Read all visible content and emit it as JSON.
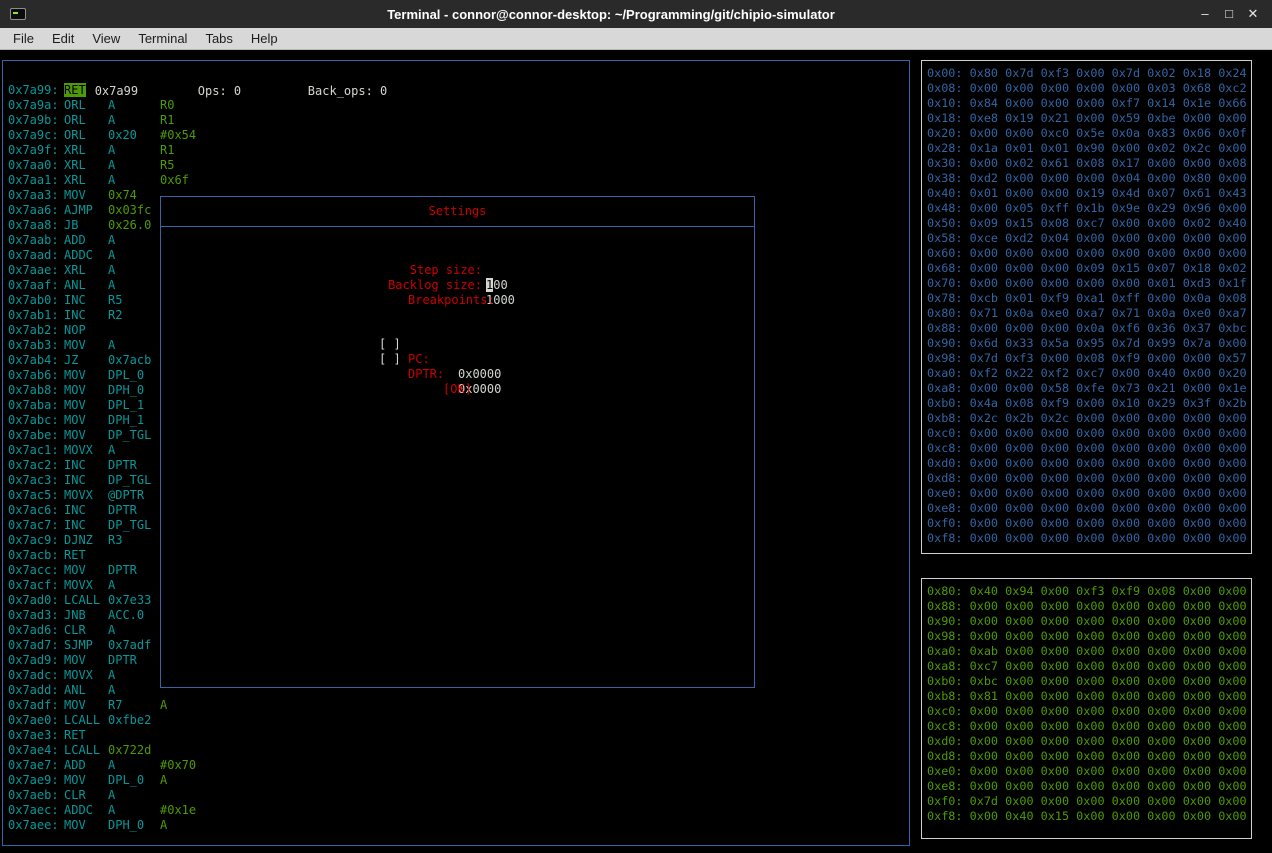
{
  "colors": {
    "cyan": "#06989a",
    "green": "#4e9a06",
    "blue": "#3465a4",
    "red": "#cc0000",
    "fg": "#d3d7cf"
  },
  "window": {
    "title": "Terminal - connor@connor-desktop: ~/Programming/git/chipio-simulator",
    "controls": {
      "minimize": "–",
      "maximize": "□",
      "close": "✕"
    }
  },
  "menubar": {
    "items": [
      "File",
      "Edit",
      "View",
      "Terminal",
      "Tabs",
      "Help"
    ]
  },
  "status_line": {
    "pc": "PC: 0x7a99",
    "ops": "Ops: 0",
    "back_ops": "Back_ops: 0"
  },
  "disassembly": {
    "rows": [
      {
        "a": "0x7a99:",
        "m": "RET",
        "cur": true
      },
      {
        "a": "0x7a9a:",
        "m": "ORL",
        "o1": "A",
        "o2": "R0"
      },
      {
        "a": "0x7a9b:",
        "m": "ORL",
        "o1": "A",
        "o2": "R1"
      },
      {
        "a": "0x7a9c:",
        "m": "ORL",
        "o1": "0x20",
        "o2": "#0x54"
      },
      {
        "a": "0x7a9f:",
        "m": "XRL",
        "o1": "A",
        "o2": "R1"
      },
      {
        "a": "0x7aa0:",
        "m": "XRL",
        "o1": "A",
        "o2": "R5"
      },
      {
        "a": "0x7aa1:",
        "m": "XRL",
        "o1": "A",
        "o2": "0x6f"
      },
      {
        "a": "0x7aa3:",
        "m": "MOV",
        "o1": "0x74",
        "g": true
      },
      {
        "a": "0x7aa6:",
        "m": "AJMP",
        "o1": "0x03fc",
        "g": true
      },
      {
        "a": "0x7aa8:",
        "m": "JB",
        "o1": "0x26.0",
        "g": true
      },
      {
        "a": "0x7aab:",
        "m": "ADD",
        "o1": "A"
      },
      {
        "a": "0x7aad:",
        "m": "ADDC",
        "o1": "A"
      },
      {
        "a": "0x7aae:",
        "m": "XRL",
        "o1": "A"
      },
      {
        "a": "0x7aaf:",
        "m": "ANL",
        "o1": "A"
      },
      {
        "a": "0x7ab0:",
        "m": "INC",
        "o1": "R5"
      },
      {
        "a": "0x7ab1:",
        "m": "INC",
        "o1": "R2"
      },
      {
        "a": "0x7ab2:",
        "m": "NOP"
      },
      {
        "a": "0x7ab3:",
        "m": "MOV",
        "o1": "A"
      },
      {
        "a": "0x7ab4:",
        "m": "JZ",
        "o1": "0x7acb"
      },
      {
        "a": "0x7ab6:",
        "m": "MOV",
        "o1": "DPL_0"
      },
      {
        "a": "0x7ab8:",
        "m": "MOV",
        "o1": "DPH_0"
      },
      {
        "a": "0x7aba:",
        "m": "MOV",
        "o1": "DPL_1"
      },
      {
        "a": "0x7abc:",
        "m": "MOV",
        "o1": "DPH_1"
      },
      {
        "a": "0x7abe:",
        "m": "MOV",
        "o1": "DP_TGL"
      },
      {
        "a": "0x7ac1:",
        "m": "MOVX",
        "o1": "A"
      },
      {
        "a": "0x7ac2:",
        "m": "INC",
        "o1": "DPTR"
      },
      {
        "a": "0x7ac3:",
        "m": "INC",
        "o1": "DP_TGL"
      },
      {
        "a": "0x7ac5:",
        "m": "MOVX",
        "o1": "@DPTR"
      },
      {
        "a": "0x7ac6:",
        "m": "INC",
        "o1": "DPTR"
      },
      {
        "a": "0x7ac7:",
        "m": "INC",
        "o1": "DP_TGL"
      },
      {
        "a": "0x7ac9:",
        "m": "DJNZ",
        "o1": "R3"
      },
      {
        "a": "0x7acb:",
        "m": "RET"
      },
      {
        "a": "0x7acc:",
        "m": "MOV",
        "o1": "DPTR"
      },
      {
        "a": "0x7acf:",
        "m": "MOVX",
        "o1": "A"
      },
      {
        "a": "0x7ad0:",
        "m": "LCALL",
        "o1": "0x7e33"
      },
      {
        "a": "0x7ad3:",
        "m": "JNB",
        "o1": "ACC.0"
      },
      {
        "a": "0x7ad6:",
        "m": "CLR",
        "o1": "A"
      },
      {
        "a": "0x7ad7:",
        "m": "SJMP",
        "o1": "0x7adf"
      },
      {
        "a": "0x7ad9:",
        "m": "MOV",
        "o1": "DPTR"
      },
      {
        "a": "0x7adc:",
        "m": "MOVX",
        "o1": "A"
      },
      {
        "a": "0x7add:",
        "m": "ANL",
        "o1": "A"
      },
      {
        "a": "0x7adf:",
        "m": "MOV",
        "o1": "R7",
        "o2": "A"
      },
      {
        "a": "0x7ae0:",
        "m": "LCALL",
        "o1": "0xfbe2"
      },
      {
        "a": "0x7ae3:",
        "m": "RET"
      },
      {
        "a": "0x7ae4:",
        "m": "LCALL",
        "o1": "0x722d",
        "g": true
      },
      {
        "a": "0x7ae7:",
        "m": "ADD",
        "o1": "A",
        "o2": "#0x70"
      },
      {
        "a": "0x7ae9:",
        "m": "MOV",
        "o1": "DPL_0",
        "o2": "A"
      },
      {
        "a": "0x7aeb:",
        "m": "CLR",
        "o1": "A"
      },
      {
        "a": "0x7aec:",
        "m": "ADDC",
        "o1": "A",
        "o2": "#0x1e"
      },
      {
        "a": "0x7aee:",
        "m": "MOV",
        "o1": "DPH_0",
        "o2": "A"
      }
    ]
  },
  "settings_dialog": {
    "title": "Settings",
    "fields": [
      {
        "label": "Step size:",
        "value": "100",
        "cursor_index": 0
      },
      {
        "label": "Backlog size:",
        "value": "1000"
      }
    ],
    "breakpoints_heading": "Breakpoints:",
    "breakpoints": [
      {
        "checkbox": "[ ]",
        "label": "PC:",
        "value": "0x0000"
      },
      {
        "checkbox": "[ ]",
        "label": "DPTR:",
        "value": "0x0000"
      }
    ],
    "ok_button": "[OK]"
  },
  "memory_internal": {
    "rows": [
      {
        "a": "0x00:",
        "v": [
          "0x80",
          "0x7d",
          "0xf3",
          "0x00",
          "0x7d",
          "0x02",
          "0x18",
          "0x24"
        ]
      },
      {
        "a": "0x08:",
        "v": [
          "0x00",
          "0x00",
          "0x00",
          "0x00",
          "0x00",
          "0x03",
          "0x68",
          "0xc2"
        ]
      },
      {
        "a": "0x10:",
        "v": [
          "0x84",
          "0x00",
          "0x00",
          "0x00",
          "0xf7",
          "0x14",
          "0x1e",
          "0x66"
        ]
      },
      {
        "a": "0x18:",
        "v": [
          "0xe8",
          "0x19",
          "0x21",
          "0x00",
          "0x59",
          "0xbe",
          "0x00",
          "0x00"
        ]
      },
      {
        "a": "0x20:",
        "v": [
          "0x00",
          "0x00",
          "0xc0",
          "0x5e",
          "0x0a",
          "0x83",
          "0x06",
          "0x0f"
        ]
      },
      {
        "a": "0x28:",
        "v": [
          "0x1a",
          "0x01",
          "0x01",
          "0x90",
          "0x00",
          "0x02",
          "0x2c",
          "0x00"
        ]
      },
      {
        "a": "0x30:",
        "v": [
          "0x00",
          "0x02",
          "0x61",
          "0x08",
          "0x17",
          "0x00",
          "0x00",
          "0x08"
        ]
      },
      {
        "a": "0x38:",
        "v": [
          "0xd2",
          "0x00",
          "0x00",
          "0x00",
          "0x04",
          "0x00",
          "0x80",
          "0x00"
        ]
      },
      {
        "a": "0x40:",
        "v": [
          "0x01",
          "0x00",
          "0x00",
          "0x19",
          "0x4d",
          "0x07",
          "0x61",
          "0x43"
        ]
      },
      {
        "a": "0x48:",
        "v": [
          "0x00",
          "0x05",
          "0xff",
          "0x1b",
          "0x9e",
          "0x29",
          "0x96",
          "0x00"
        ]
      },
      {
        "a": "0x50:",
        "v": [
          "0x09",
          "0x15",
          "0x08",
          "0xc7",
          "0x00",
          "0x00",
          "0x02",
          "0x40"
        ]
      },
      {
        "a": "0x58:",
        "v": [
          "0xce",
          "0xd2",
          "0x04",
          "0x00",
          "0x00",
          "0x00",
          "0x00",
          "0x00"
        ]
      },
      {
        "a": "0x60:",
        "v": [
          "0x00",
          "0x00",
          "0x00",
          "0x00",
          "0x00",
          "0x00",
          "0x00",
          "0x00"
        ]
      },
      {
        "a": "0x68:",
        "v": [
          "0x00",
          "0x00",
          "0x00",
          "0x09",
          "0x15",
          "0x07",
          "0x18",
          "0x02"
        ]
      },
      {
        "a": "0x70:",
        "v": [
          "0x00",
          "0x00",
          "0x00",
          "0x00",
          "0x00",
          "0x01",
          "0xd3",
          "0x1f"
        ]
      },
      {
        "a": "0x78:",
        "v": [
          "0xcb",
          "0x01",
          "0xf9",
          "0xa1",
          "0xff",
          "0x00",
          "0x0a",
          "0x08"
        ]
      },
      {
        "a": "0x80:",
        "v": [
          "0x71",
          "0x0a",
          "0xe0",
          "0xa7",
          "0x71",
          "0x0a",
          "0xe0",
          "0xa7"
        ]
      },
      {
        "a": "0x88:",
        "v": [
          "0x00",
          "0x00",
          "0x00",
          "0x0a",
          "0xf6",
          "0x36",
          "0x37",
          "0xbc"
        ]
      },
      {
        "a": "0x90:",
        "v": [
          "0x6d",
          "0x33",
          "0x5a",
          "0x95",
          "0x7d",
          "0x99",
          "0x7a",
          "0x00"
        ]
      },
      {
        "a": "0x98:",
        "v": [
          "0x7d",
          "0xf3",
          "0x00",
          "0x08",
          "0xf9",
          "0x00",
          "0x00",
          "0x57"
        ]
      },
      {
        "a": "0xa0:",
        "v": [
          "0xf2",
          "0x22",
          "0xf2",
          "0xc7",
          "0x00",
          "0x40",
          "0x00",
          "0x20"
        ]
      },
      {
        "a": "0xa8:",
        "v": [
          "0x00",
          "0x00",
          "0x58",
          "0xfe",
          "0x73",
          "0x21",
          "0x00",
          "0x1e"
        ]
      },
      {
        "a": "0xb0:",
        "v": [
          "0x4a",
          "0x08",
          "0xf9",
          "0x00",
          "0x10",
          "0x29",
          "0x3f",
          "0x2b"
        ]
      },
      {
        "a": "0xb8:",
        "v": [
          "0x2c",
          "0x2b",
          "0x2c",
          "0x00",
          "0x00",
          "0x00",
          "0x00",
          "0x00"
        ]
      },
      {
        "a": "0xc0:",
        "v": [
          "0x00",
          "0x00",
          "0x00",
          "0x00",
          "0x00",
          "0x00",
          "0x00",
          "0x00"
        ]
      },
      {
        "a": "0xc8:",
        "v": [
          "0x00",
          "0x00",
          "0x00",
          "0x00",
          "0x00",
          "0x00",
          "0x00",
          "0x00"
        ]
      },
      {
        "a": "0xd0:",
        "v": [
          "0x00",
          "0x00",
          "0x00",
          "0x00",
          "0x00",
          "0x00",
          "0x00",
          "0x00"
        ]
      },
      {
        "a": "0xd8:",
        "v": [
          "0x00",
          "0x00",
          "0x00",
          "0x00",
          "0x00",
          "0x00",
          "0x00",
          "0x00"
        ]
      },
      {
        "a": "0xe0:",
        "v": [
          "0x00",
          "0x00",
          "0x00",
          "0x00",
          "0x00",
          "0x00",
          "0x00",
          "0x00"
        ]
      },
      {
        "a": "0xe8:",
        "v": [
          "0x00",
          "0x00",
          "0x00",
          "0x00",
          "0x00",
          "0x00",
          "0x00",
          "0x00"
        ]
      },
      {
        "a": "0xf0:",
        "v": [
          "0x00",
          "0x00",
          "0x00",
          "0x00",
          "0x00",
          "0x00",
          "0x00",
          "0x00"
        ]
      },
      {
        "a": "0xf8:",
        "v": [
          "0x00",
          "0x00",
          "0x00",
          "0x00",
          "0x00",
          "0x00",
          "0x00",
          "0x00"
        ]
      }
    ]
  },
  "memory_external": {
    "rows": [
      {
        "a": "0x80:",
        "v": [
          "0x40",
          "0x94",
          "0x00",
          "0xf3",
          "0xf9",
          "0x08",
          "0x00",
          "0x00"
        ]
      },
      {
        "a": "0x88:",
        "v": [
          "0x00",
          "0x00",
          "0x00",
          "0x00",
          "0x00",
          "0x00",
          "0x00",
          "0x00"
        ]
      },
      {
        "a": "0x90:",
        "v": [
          "0x00",
          "0x00",
          "0x00",
          "0x00",
          "0x00",
          "0x00",
          "0x00",
          "0x00"
        ]
      },
      {
        "a": "0x98:",
        "v": [
          "0x00",
          "0x00",
          "0x00",
          "0x00",
          "0x00",
          "0x00",
          "0x00",
          "0x00"
        ]
      },
      {
        "a": "0xa0:",
        "v": [
          "0xab",
          "0x00",
          "0x00",
          "0x00",
          "0x00",
          "0x00",
          "0x00",
          "0x00"
        ]
      },
      {
        "a": "0xa8:",
        "v": [
          "0xc7",
          "0x00",
          "0x00",
          "0x00",
          "0x00",
          "0x00",
          "0x00",
          "0x00"
        ]
      },
      {
        "a": "0xb0:",
        "v": [
          "0xbc",
          "0x00",
          "0x00",
          "0x00",
          "0x00",
          "0x00",
          "0x00",
          "0x00"
        ]
      },
      {
        "a": "0xb8:",
        "v": [
          "0x81",
          "0x00",
          "0x00",
          "0x00",
          "0x00",
          "0x00",
          "0x00",
          "0x00"
        ]
      },
      {
        "a": "0xc0:",
        "v": [
          "0x00",
          "0x00",
          "0x00",
          "0x00",
          "0x00",
          "0x00",
          "0x00",
          "0x00"
        ]
      },
      {
        "a": "0xc8:",
        "v": [
          "0x00",
          "0x00",
          "0x00",
          "0x00",
          "0x00",
          "0x00",
          "0x00",
          "0x00"
        ]
      },
      {
        "a": "0xd0:",
        "v": [
          "0x00",
          "0x00",
          "0x00",
          "0x00",
          "0x00",
          "0x00",
          "0x00",
          "0x00"
        ]
      },
      {
        "a": "0xd8:",
        "v": [
          "0x00",
          "0x00",
          "0x00",
          "0x00",
          "0x00",
          "0x00",
          "0x00",
          "0x00"
        ]
      },
      {
        "a": "0xe0:",
        "v": [
          "0x00",
          "0x00",
          "0x00",
          "0x00",
          "0x00",
          "0x00",
          "0x00",
          "0x00"
        ]
      },
      {
        "a": "0xe8:",
        "v": [
          "0x00",
          "0x00",
          "0x00",
          "0x00",
          "0x00",
          "0x00",
          "0x00",
          "0x00"
        ]
      },
      {
        "a": "0xf0:",
        "v": [
          "0x7d",
          "0x00",
          "0x00",
          "0x00",
          "0x00",
          "0x00",
          "0x00",
          "0x00"
        ]
      },
      {
        "a": "0xf8:",
        "v": [
          "0x00",
          "0x40",
          "0x15",
          "0x00",
          "0x00",
          "0x00",
          "0x00",
          "0x00"
        ]
      }
    ]
  }
}
